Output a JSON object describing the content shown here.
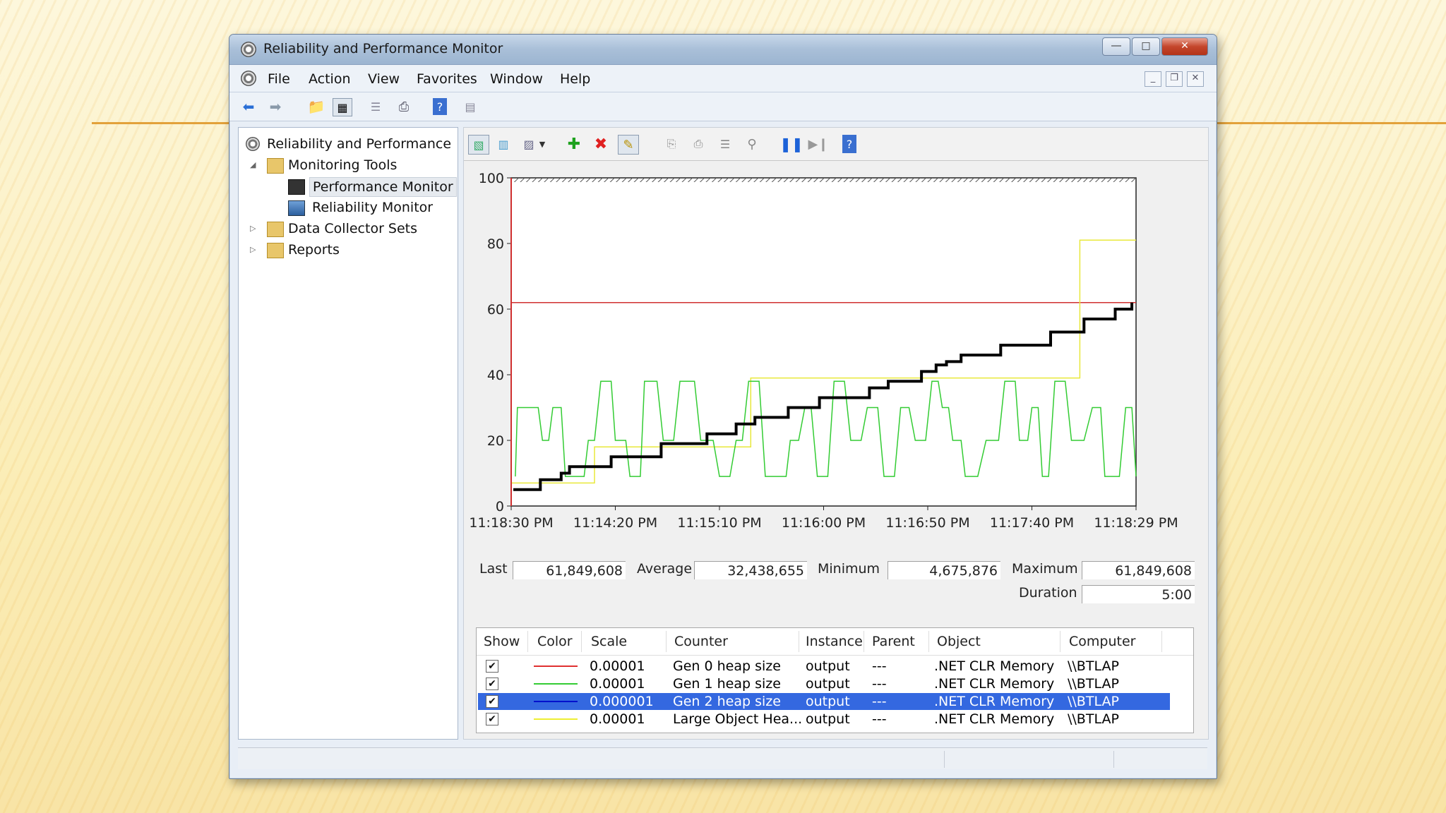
{
  "window": {
    "title": "Reliability and Performance Monitor"
  },
  "menu": [
    "File",
    "Action",
    "View",
    "Favorites",
    "Window",
    "Help"
  ],
  "tree": {
    "root": "Reliability and Performance",
    "monitoring_tools": "Monitoring Tools",
    "performance_monitor": "Performance Monitor",
    "reliability_monitor": "Reliability Monitor",
    "data_collector_sets": "Data Collector Sets",
    "reports": "Reports"
  },
  "stats": {
    "last_label": "Last",
    "last_value": "61,849,608",
    "average_label": "Average",
    "average_value": "32,438,655",
    "minimum_label": "Minimum",
    "minimum_value": "4,675,876",
    "maximum_label": "Maximum",
    "maximum_value": "61,849,608",
    "duration_label": "Duration",
    "duration_value": "5:00"
  },
  "legend": {
    "headers": [
      "Show",
      "Color",
      "Scale",
      "Counter",
      "Instance",
      "Parent",
      "Object",
      "Computer"
    ],
    "rows": [
      {
        "color": "#e03030",
        "scale": "0.00001",
        "counter": "Gen 0 heap size",
        "instance": "output",
        "parent": "---",
        "object": ".NET CLR Memory",
        "computer": "\\\\BTLAP",
        "selected": false
      },
      {
        "color": "#33cc33",
        "scale": "0.00001",
        "counter": "Gen 1 heap size",
        "instance": "output",
        "parent": "---",
        "object": ".NET CLR Memory",
        "computer": "\\\\BTLAP",
        "selected": false
      },
      {
        "color": "#0010cc",
        "scale": "0.000001",
        "counter": "Gen 2 heap size",
        "instance": "output",
        "parent": "---",
        "object": ".NET CLR Memory",
        "computer": "\\\\BTLAP",
        "selected": true
      },
      {
        "color": "#eeee33",
        "scale": "0.00001",
        "counter": "Large Object Hea...",
        "instance": "output",
        "parent": "---",
        "object": ".NET CLR Memory",
        "computer": "\\\\BTLAP",
        "selected": false
      }
    ]
  },
  "chart_data": {
    "type": "line",
    "yticks": [
      "0",
      "20",
      "40",
      "60",
      "80",
      "100"
    ],
    "xticks": [
      "11:18:30 PM",
      "11:14:20 PM",
      "11:15:10 PM",
      "11:16:00 PM",
      "11:16:50 PM",
      "11:17:40 PM",
      "11:18:29 PM"
    ],
    "ylim": [
      0,
      100
    ],
    "xlim": [
      0,
      300
    ],
    "series": [
      {
        "name": "Gen 0 heap size",
        "color": "#d03030",
        "width": 1.5,
        "points": [
          [
            0,
            0
          ],
          [
            0,
            62
          ],
          [
            300,
            62
          ]
        ]
      },
      {
        "name": "Large Object Hea...",
        "color": "#e8e83a",
        "width": 1.5,
        "points": [
          [
            0,
            7
          ],
          [
            40,
            7
          ],
          [
            40,
            18
          ],
          [
            115,
            18
          ],
          [
            115,
            39
          ],
          [
            273,
            39
          ],
          [
            273,
            81
          ],
          [
            300,
            81
          ]
        ]
      },
      {
        "name": "Gen 1 heap size",
        "color": "#33cc33",
        "width": 1.5,
        "points": [
          [
            2,
            9
          ],
          [
            3,
            30
          ],
          [
            13,
            30
          ],
          [
            15,
            20
          ],
          [
            18,
            20
          ],
          [
            20,
            30
          ],
          [
            24,
            30
          ],
          [
            26,
            9
          ],
          [
            35,
            9
          ],
          [
            37,
            20
          ],
          [
            40,
            20
          ],
          [
            43,
            38
          ],
          [
            48,
            38
          ],
          [
            50,
            20
          ],
          [
            55,
            20
          ],
          [
            57,
            9
          ],
          [
            62,
            9
          ],
          [
            64,
            38
          ],
          [
            70,
            38
          ],
          [
            73,
            20
          ],
          [
            78,
            20
          ],
          [
            81,
            38
          ],
          [
            88,
            38
          ],
          [
            91,
            20
          ],
          [
            97,
            20
          ],
          [
            100,
            9
          ],
          [
            105,
            9
          ],
          [
            108,
            20
          ],
          [
            111,
            20
          ],
          [
            114,
            38
          ],
          [
            119,
            38
          ],
          [
            122,
            9
          ],
          [
            132,
            9
          ],
          [
            134,
            20
          ],
          [
            138,
            20
          ],
          [
            141,
            30
          ],
          [
            144,
            30
          ],
          [
            147,
            9
          ],
          [
            152,
            9
          ],
          [
            155,
            38
          ],
          [
            160,
            38
          ],
          [
            163,
            20
          ],
          [
            168,
            20
          ],
          [
            171,
            30
          ],
          [
            176,
            30
          ],
          [
            179,
            9
          ],
          [
            184,
            9
          ],
          [
            187,
            30
          ],
          [
            191,
            30
          ],
          [
            194,
            20
          ],
          [
            199,
            20
          ],
          [
            202,
            38
          ],
          [
            205,
            38
          ],
          [
            207,
            30
          ],
          [
            210,
            30
          ],
          [
            212,
            20
          ],
          [
            216,
            20
          ],
          [
            218,
            9
          ],
          [
            224,
            9
          ],
          [
            228,
            20
          ],
          [
            234,
            20
          ],
          [
            237,
            38
          ],
          [
            242,
            38
          ],
          [
            244,
            20
          ],
          [
            248,
            20
          ],
          [
            250,
            30
          ],
          [
            253,
            30
          ],
          [
            255,
            9
          ],
          [
            258,
            9
          ],
          [
            261,
            38
          ],
          [
            266,
            38
          ],
          [
            269,
            20
          ],
          [
            275,
            20
          ],
          [
            279,
            30
          ],
          [
            283,
            30
          ],
          [
            285,
            9
          ],
          [
            292,
            9
          ],
          [
            295,
            30
          ],
          [
            298,
            30
          ],
          [
            300,
            9
          ]
        ]
      },
      {
        "name": "Gen 2 heap size",
        "color": "#000000",
        "width": 4,
        "points": [
          [
            1,
            5
          ],
          [
            14,
            5
          ],
          [
            14,
            8
          ],
          [
            24,
            8
          ],
          [
            24,
            10
          ],
          [
            28,
            10
          ],
          [
            28,
            12
          ],
          [
            48,
            12
          ],
          [
            48,
            15
          ],
          [
            72,
            15
          ],
          [
            72,
            19
          ],
          [
            94,
            19
          ],
          [
            94,
            22
          ],
          [
            108,
            22
          ],
          [
            108,
            25
          ],
          [
            117,
            25
          ],
          [
            117,
            27
          ],
          [
            133,
            27
          ],
          [
            133,
            30
          ],
          [
            148,
            30
          ],
          [
            148,
            33
          ],
          [
            172,
            33
          ],
          [
            172,
            36
          ],
          [
            181,
            36
          ],
          [
            181,
            38
          ],
          [
            197,
            38
          ],
          [
            197,
            41
          ],
          [
            204,
            41
          ],
          [
            204,
            43
          ],
          [
            209,
            43
          ],
          [
            209,
            44
          ],
          [
            216,
            44
          ],
          [
            216,
            46
          ],
          [
            235,
            46
          ],
          [
            235,
            49
          ],
          [
            259,
            49
          ],
          [
            259,
            53
          ],
          [
            275,
            53
          ],
          [
            275,
            57
          ],
          [
            290,
            57
          ],
          [
            290,
            60
          ],
          [
            298,
            60
          ],
          [
            298,
            62
          ]
        ]
      }
    ]
  }
}
